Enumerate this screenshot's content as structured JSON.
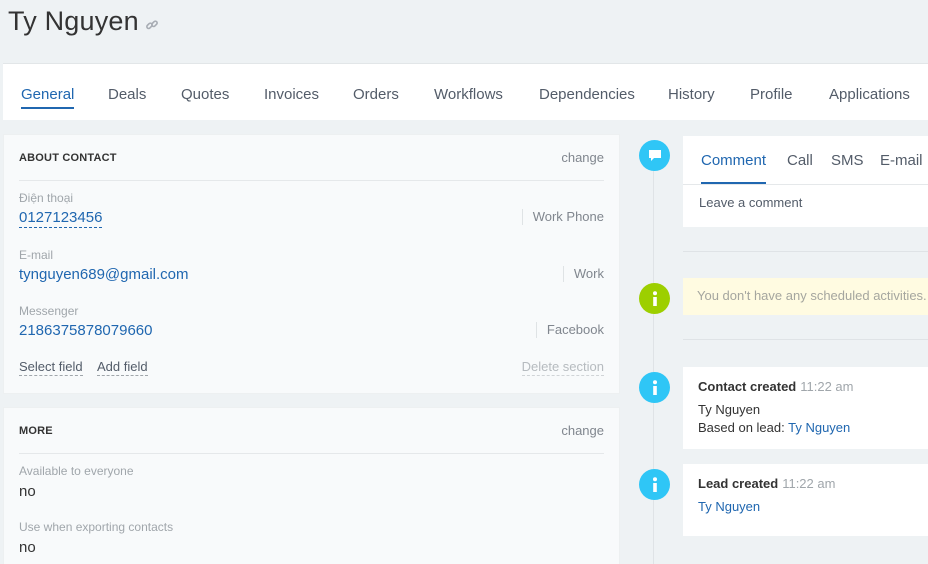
{
  "header": {
    "title": "Ty Nguyen"
  },
  "tabs": [
    {
      "label": "General"
    },
    {
      "label": "Deals"
    },
    {
      "label": "Quotes"
    },
    {
      "label": "Invoices"
    },
    {
      "label": "Orders"
    },
    {
      "label": "Workflows"
    },
    {
      "label": "Dependencies"
    },
    {
      "label": "History"
    },
    {
      "label": "Profile"
    },
    {
      "label": "Applications"
    }
  ],
  "about": {
    "heading": "ABOUT CONTACT",
    "change": "change",
    "fields": [
      {
        "label": "Điện thoại",
        "value": "0127123456",
        "type": "Work Phone"
      },
      {
        "label": "E-mail",
        "value": "tynguyen689@gmail.com",
        "type": "Work"
      },
      {
        "label": "Messenger",
        "value": "2186375878079660",
        "type": "Facebook"
      }
    ],
    "select_field": "Select field",
    "add_field": "Add field",
    "delete_section": "Delete section"
  },
  "more": {
    "heading": "MORE",
    "change": "change",
    "fields": [
      {
        "label": "Available to everyone",
        "value": "no"
      },
      {
        "label": "Use when exporting contacts",
        "value": "no"
      }
    ]
  },
  "composer": {
    "tabs": [
      {
        "label": "Comment"
      },
      {
        "label": "Call"
      },
      {
        "label": "SMS"
      },
      {
        "label": "E-mail"
      }
    ],
    "placeholder": "Leave a comment"
  },
  "scheduled": {
    "text": "You don't have any scheduled activities."
  },
  "events": [
    {
      "title": "Contact created",
      "time": "11:22 am",
      "line1": "Ty Nguyen",
      "based_label": "Based on lead: ",
      "based_link": "Ty Nguyen"
    },
    {
      "title": "Lead created",
      "time": "11:22 am",
      "link": "Ty Nguyen"
    }
  ],
  "colors": {
    "accent": "#2067b0",
    "timeline_blue": "#2fc6f6",
    "timeline_green": "#9dcf00",
    "scheduled_bg": "#fffbe1"
  }
}
